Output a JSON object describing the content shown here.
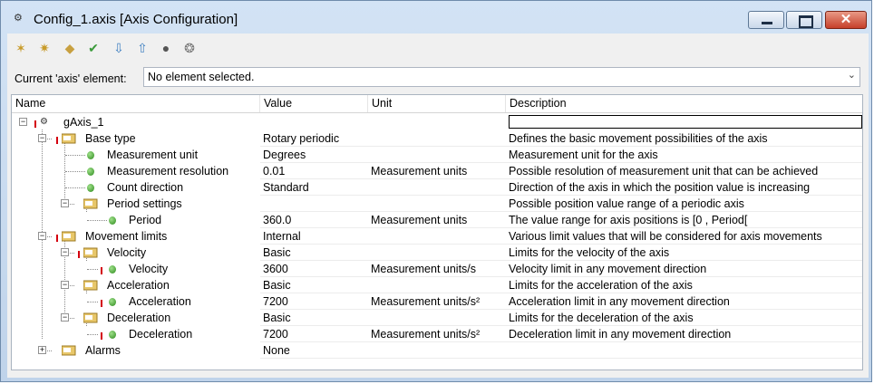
{
  "window": {
    "title": "Config_1.axis [Axis Configuration]",
    "close_glyph": "✕"
  },
  "toolbar": {
    "icons": [
      "add-element-icon",
      "add-subelement-icon",
      "move-icon",
      "check-icon",
      "sort-down-icon",
      "sort-up-icon",
      "circle-icon",
      "circles-icon"
    ]
  },
  "combo": {
    "label": "Current 'axis' element:",
    "value": "No element selected."
  },
  "grid": {
    "headers": {
      "name": "Name",
      "value": "Value",
      "unit": "Unit",
      "description": "Description"
    },
    "rows": [
      {
        "name": "gAxis_1",
        "value": "",
        "unit": "",
        "desc": ""
      },
      {
        "name": "Base type",
        "value": "Rotary periodic",
        "unit": "",
        "desc": "Defines the basic movement possibilities of the axis"
      },
      {
        "name": "Measurement unit",
        "value": "Degrees",
        "unit": "",
        "desc": "Measurement unit for the axis"
      },
      {
        "name": "Measurement resolution",
        "value": "0.01",
        "unit": "Measurement units",
        "desc": "Possible resolution of measurement unit that can be achieved"
      },
      {
        "name": "Count direction",
        "value": "Standard",
        "unit": "",
        "desc": "Direction of the axis in which the position value is increasing"
      },
      {
        "name": "Period settings",
        "value": "",
        "unit": "",
        "desc": "Possible position value range of a periodic axis"
      },
      {
        "name": "Period",
        "value": "360.0",
        "unit": "Measurement units",
        "desc": "The value range for axis positions is [0 , Period["
      },
      {
        "name": "Movement limits",
        "value": "Internal",
        "unit": "",
        "desc": "Various limit values that will be considered for axis movements"
      },
      {
        "name": "Velocity",
        "value": "Basic",
        "unit": "",
        "desc": "Limits for the velocity of the axis"
      },
      {
        "name": "Velocity",
        "value": "3600",
        "unit": "Measurement units/s",
        "desc": "Velocity limit in any movement direction"
      },
      {
        "name": "Acceleration",
        "value": "Basic",
        "unit": "",
        "desc": "Limits for the acceleration of the axis"
      },
      {
        "name": "Acceleration",
        "value": "7200",
        "unit": "Measurement units/s²",
        "desc": "Acceleration limit in any movement direction"
      },
      {
        "name": "Deceleration",
        "value": "Basic",
        "unit": "",
        "desc": "Limits for the deceleration of the axis"
      },
      {
        "name": "Deceleration",
        "value": "7200",
        "unit": "Measurement units/s²",
        "desc": "Deceleration limit in any movement direction"
      },
      {
        "name": "Alarms",
        "value": "None",
        "unit": "",
        "desc": ""
      }
    ]
  }
}
